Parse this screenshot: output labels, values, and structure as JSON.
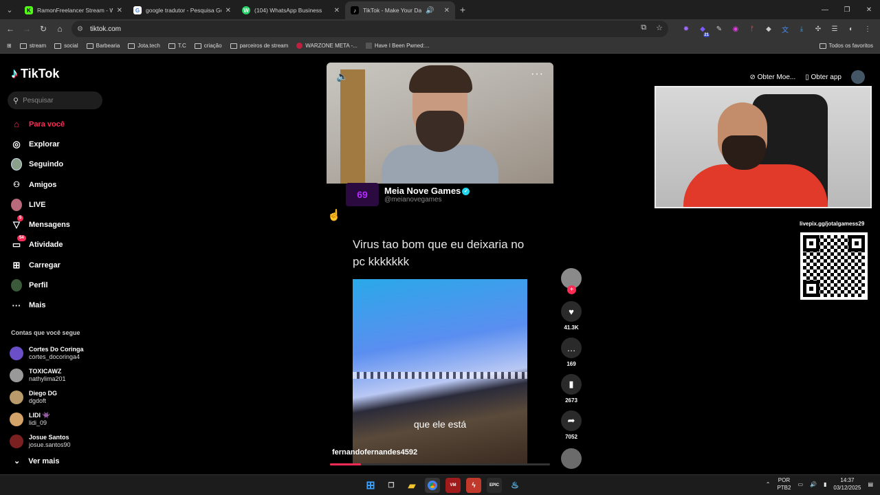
{
  "browser": {
    "tabs": [
      {
        "title": "RamonFreelancer Stream - Wa",
        "icon": "kick-favicon",
        "color": "#53fc18",
        "glyph": "K"
      },
      {
        "title": "google tradutor - Pesquisa Goo",
        "icon": "google-favicon",
        "color": "#ffffff",
        "glyph": "G"
      },
      {
        "title": "(104) WhatsApp Business",
        "icon": "whatsapp-favicon",
        "color": "#25d366",
        "glyph": "W"
      },
      {
        "title": "TikTok - Make Your Day",
        "icon": "tiktok-favicon",
        "color": "#000000",
        "glyph": "♪"
      }
    ],
    "url": "tiktok.com",
    "extension_badge": "21",
    "bookmarks": [
      "stream",
      "social",
      "Barbearia",
      "Jota.tech",
      "T.C",
      "criação",
      "parceiros de stream",
      "WARZONE META -...",
      "Have I Been Pwned:..."
    ],
    "all_bookmarks": "Todos os favoritos"
  },
  "tiktok": {
    "logo_text": "TikTok",
    "search_placeholder": "Pesquisar",
    "nav": [
      {
        "label": "Para você",
        "icon": "home-icon",
        "glyph": "⌂"
      },
      {
        "label": "Explorar",
        "icon": "compass-icon",
        "glyph": "◎"
      },
      {
        "label": "Seguindo",
        "icon": "following-avatar-icon",
        "glyph": ""
      },
      {
        "label": "Amigos",
        "icon": "friends-icon",
        "glyph": "👥"
      },
      {
        "label": "LIVE",
        "icon": "live-avatar-icon",
        "glyph": ""
      },
      {
        "label": "Mensagens",
        "icon": "messages-icon",
        "glyph": "▽",
        "badge": "5"
      },
      {
        "label": "Atividade",
        "icon": "activity-icon",
        "glyph": "▭",
        "badge": "54"
      },
      {
        "label": "Carregar",
        "icon": "upload-icon",
        "glyph": "⊞"
      },
      {
        "label": "Perfil",
        "icon": "profile-avatar-icon",
        "glyph": ""
      },
      {
        "label": "Mais",
        "icon": "more-icon",
        "glyph": "···"
      }
    ],
    "following_title": "Contas que você segue",
    "following": [
      {
        "name": "Cortes Do Coringa",
        "handle": "cortes_docoringa4",
        "color": "#6a4fc9"
      },
      {
        "name": "TOXICAWZ",
        "handle": "nathylima201",
        "color": "#999999"
      },
      {
        "name": "Diego DG",
        "handle": "dgdoft",
        "color": "#b99a6a"
      },
      {
        "name": "LIDI 👾",
        "handle": "lidi_09",
        "color": "#d4a36a"
      },
      {
        "name": "Josue Santos",
        "handle": "josue.santos90",
        "color": "#7a2020"
      }
    ],
    "see_more": "Ver mais",
    "top_right": {
      "coins": "Obter Moe...",
      "app": "Obter app"
    },
    "post": {
      "channel_name": "Meia Nove Games",
      "channel_handle": "@meianovegames",
      "channel_logo_text": "69",
      "caption": "Virus tao bom que eu deixaria no pc kkkkkkk",
      "subtitle": "que ele está",
      "uploader": "fernandofernandes4592",
      "progress": 0.14,
      "likes": "41.3K",
      "comments": "169",
      "saves": "2673",
      "shares": "7052"
    },
    "livepix": "livepix.gg/jotalgamess29"
  },
  "taskbar": {
    "language": "POR",
    "layout": "PTB2",
    "time": "14:37",
    "date": "03/12/2025"
  }
}
